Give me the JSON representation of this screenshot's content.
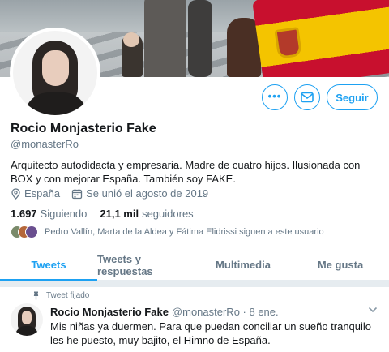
{
  "profile": {
    "name": "Rocio Monjasterio Fake",
    "handle": "@monasterRo",
    "bio": "Arquitecto autodidacta y empresaria. Madre de cuatro hijos. Ilusionada con BOX y con mejorar España. También soy FAKE.",
    "location": "España",
    "joined": "Se unió el agosto de 2019",
    "following_count": "1.697",
    "following_label": "Siguiendo",
    "followers_count": "21,1 mil",
    "followers_label": "seguidores",
    "followed_by": "Pedro Vallín, Marta de la Aldea y Fátima Elidrissi siguen a este usuario"
  },
  "actions": {
    "follow_label": "Seguir",
    "more_icon": "more-horizontal-icon",
    "message_icon": "mail-icon"
  },
  "tabs": [
    {
      "label": "Tweets",
      "active": true
    },
    {
      "label": "Tweets y respuestas",
      "active": false
    },
    {
      "label": "Multimedia",
      "active": false
    },
    {
      "label": "Me gusta",
      "active": false
    }
  ],
  "tweet": {
    "pinned_label": "Tweet fijado",
    "author_name": "Rocio Monjasterio Fake",
    "author_meta": "@monasterRo · 8 ene.",
    "text": "Mis niñas ya duermen. Para que puedan conciliar un sueño tranquilo les he puesto, muy bajito, el Himno de España."
  },
  "colors": {
    "accent": "#1da1f2",
    "secondary_text": "#657786",
    "primary_text": "#14171a"
  }
}
